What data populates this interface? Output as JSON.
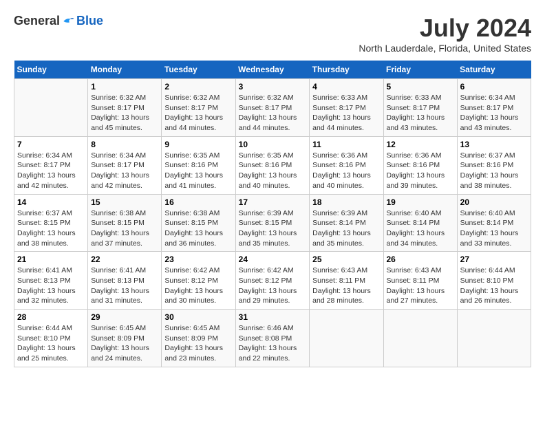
{
  "header": {
    "logo": {
      "general": "General",
      "blue": "Blue"
    },
    "title": "July 2024",
    "location": "North Lauderdale, Florida, United States"
  },
  "weekdays": [
    "Sunday",
    "Monday",
    "Tuesday",
    "Wednesday",
    "Thursday",
    "Friday",
    "Saturday"
  ],
  "weeks": [
    [
      {
        "day": null,
        "sunrise": null,
        "sunset": null,
        "daylight": null
      },
      {
        "day": "1",
        "sunrise": "Sunrise: 6:32 AM",
        "sunset": "Sunset: 8:17 PM",
        "daylight": "Daylight: 13 hours and 45 minutes."
      },
      {
        "day": "2",
        "sunrise": "Sunrise: 6:32 AM",
        "sunset": "Sunset: 8:17 PM",
        "daylight": "Daylight: 13 hours and 44 minutes."
      },
      {
        "day": "3",
        "sunrise": "Sunrise: 6:32 AM",
        "sunset": "Sunset: 8:17 PM",
        "daylight": "Daylight: 13 hours and 44 minutes."
      },
      {
        "day": "4",
        "sunrise": "Sunrise: 6:33 AM",
        "sunset": "Sunset: 8:17 PM",
        "daylight": "Daylight: 13 hours and 44 minutes."
      },
      {
        "day": "5",
        "sunrise": "Sunrise: 6:33 AM",
        "sunset": "Sunset: 8:17 PM",
        "daylight": "Daylight: 13 hours and 43 minutes."
      },
      {
        "day": "6",
        "sunrise": "Sunrise: 6:34 AM",
        "sunset": "Sunset: 8:17 PM",
        "daylight": "Daylight: 13 hours and 43 minutes."
      }
    ],
    [
      {
        "day": "7",
        "sunrise": "Sunrise: 6:34 AM",
        "sunset": "Sunset: 8:17 PM",
        "daylight": "Daylight: 13 hours and 42 minutes."
      },
      {
        "day": "8",
        "sunrise": "Sunrise: 6:34 AM",
        "sunset": "Sunset: 8:17 PM",
        "daylight": "Daylight: 13 hours and 42 minutes."
      },
      {
        "day": "9",
        "sunrise": "Sunrise: 6:35 AM",
        "sunset": "Sunset: 8:16 PM",
        "daylight": "Daylight: 13 hours and 41 minutes."
      },
      {
        "day": "10",
        "sunrise": "Sunrise: 6:35 AM",
        "sunset": "Sunset: 8:16 PM",
        "daylight": "Daylight: 13 hours and 40 minutes."
      },
      {
        "day": "11",
        "sunrise": "Sunrise: 6:36 AM",
        "sunset": "Sunset: 8:16 PM",
        "daylight": "Daylight: 13 hours and 40 minutes."
      },
      {
        "day": "12",
        "sunrise": "Sunrise: 6:36 AM",
        "sunset": "Sunset: 8:16 PM",
        "daylight": "Daylight: 13 hours and 39 minutes."
      },
      {
        "day": "13",
        "sunrise": "Sunrise: 6:37 AM",
        "sunset": "Sunset: 8:16 PM",
        "daylight": "Daylight: 13 hours and 38 minutes."
      }
    ],
    [
      {
        "day": "14",
        "sunrise": "Sunrise: 6:37 AM",
        "sunset": "Sunset: 8:15 PM",
        "daylight": "Daylight: 13 hours and 38 minutes."
      },
      {
        "day": "15",
        "sunrise": "Sunrise: 6:38 AM",
        "sunset": "Sunset: 8:15 PM",
        "daylight": "Daylight: 13 hours and 37 minutes."
      },
      {
        "day": "16",
        "sunrise": "Sunrise: 6:38 AM",
        "sunset": "Sunset: 8:15 PM",
        "daylight": "Daylight: 13 hours and 36 minutes."
      },
      {
        "day": "17",
        "sunrise": "Sunrise: 6:39 AM",
        "sunset": "Sunset: 8:15 PM",
        "daylight": "Daylight: 13 hours and 35 minutes."
      },
      {
        "day": "18",
        "sunrise": "Sunrise: 6:39 AM",
        "sunset": "Sunset: 8:14 PM",
        "daylight": "Daylight: 13 hours and 35 minutes."
      },
      {
        "day": "19",
        "sunrise": "Sunrise: 6:40 AM",
        "sunset": "Sunset: 8:14 PM",
        "daylight": "Daylight: 13 hours and 34 minutes."
      },
      {
        "day": "20",
        "sunrise": "Sunrise: 6:40 AM",
        "sunset": "Sunset: 8:14 PM",
        "daylight": "Daylight: 13 hours and 33 minutes."
      }
    ],
    [
      {
        "day": "21",
        "sunrise": "Sunrise: 6:41 AM",
        "sunset": "Sunset: 8:13 PM",
        "daylight": "Daylight: 13 hours and 32 minutes."
      },
      {
        "day": "22",
        "sunrise": "Sunrise: 6:41 AM",
        "sunset": "Sunset: 8:13 PM",
        "daylight": "Daylight: 13 hours and 31 minutes."
      },
      {
        "day": "23",
        "sunrise": "Sunrise: 6:42 AM",
        "sunset": "Sunset: 8:12 PM",
        "daylight": "Daylight: 13 hours and 30 minutes."
      },
      {
        "day": "24",
        "sunrise": "Sunrise: 6:42 AM",
        "sunset": "Sunset: 8:12 PM",
        "daylight": "Daylight: 13 hours and 29 minutes."
      },
      {
        "day": "25",
        "sunrise": "Sunrise: 6:43 AM",
        "sunset": "Sunset: 8:11 PM",
        "daylight": "Daylight: 13 hours and 28 minutes."
      },
      {
        "day": "26",
        "sunrise": "Sunrise: 6:43 AM",
        "sunset": "Sunset: 8:11 PM",
        "daylight": "Daylight: 13 hours and 27 minutes."
      },
      {
        "day": "27",
        "sunrise": "Sunrise: 6:44 AM",
        "sunset": "Sunset: 8:10 PM",
        "daylight": "Daylight: 13 hours and 26 minutes."
      }
    ],
    [
      {
        "day": "28",
        "sunrise": "Sunrise: 6:44 AM",
        "sunset": "Sunset: 8:10 PM",
        "daylight": "Daylight: 13 hours and 25 minutes."
      },
      {
        "day": "29",
        "sunrise": "Sunrise: 6:45 AM",
        "sunset": "Sunset: 8:09 PM",
        "daylight": "Daylight: 13 hours and 24 minutes."
      },
      {
        "day": "30",
        "sunrise": "Sunrise: 6:45 AM",
        "sunset": "Sunset: 8:09 PM",
        "daylight": "Daylight: 13 hours and 23 minutes."
      },
      {
        "day": "31",
        "sunrise": "Sunrise: 6:46 AM",
        "sunset": "Sunset: 8:08 PM",
        "daylight": "Daylight: 13 hours and 22 minutes."
      },
      {
        "day": null,
        "sunrise": null,
        "sunset": null,
        "daylight": null
      },
      {
        "day": null,
        "sunrise": null,
        "sunset": null,
        "daylight": null
      },
      {
        "day": null,
        "sunrise": null,
        "sunset": null,
        "daylight": null
      }
    ]
  ]
}
